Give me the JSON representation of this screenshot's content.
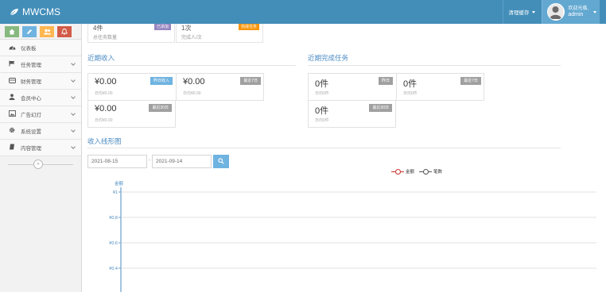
{
  "brand": {
    "title": "MWCMS",
    "logo_icon": "leaf-icon"
  },
  "navbar": {
    "clear_cache": "清理缓存",
    "welcome": "欢迎光临,",
    "username": "admin"
  },
  "colors": {
    "navbar": "#438eb9",
    "section_title": "#4a8bc2",
    "sidebar_bg": "#f2f2f2"
  },
  "sidebar": {
    "shortcuts": [
      {
        "icon": "home-icon",
        "color": "#87b87f"
      },
      {
        "icon": "pencil-icon",
        "color": "#6fb3e0"
      },
      {
        "icon": "users-icon",
        "color": "#ffb752"
      },
      {
        "icon": "bell-icon",
        "color": "#d15b47"
      }
    ],
    "items": [
      {
        "label": "仪表板",
        "icon": "dashboard-icon",
        "expandable": false
      },
      {
        "label": "任务管理",
        "icon": "flag-icon",
        "expandable": true
      },
      {
        "label": "财务管理",
        "icon": "wallet-icon",
        "expandable": true
      },
      {
        "label": "会员中心",
        "icon": "user-icon",
        "expandable": true
      },
      {
        "label": "广告幻灯",
        "icon": "picture-icon",
        "expandable": true
      },
      {
        "label": "系统设置",
        "icon": "gear-icon",
        "expandable": true
      },
      {
        "label": "内容管理",
        "icon": "book-icon",
        "expandable": true
      }
    ]
  },
  "top_partials": [
    {
      "big": "4件",
      "small": "总任务数量",
      "badge": "已添加",
      "badge_color": "#9585bf"
    },
    {
      "big": "1次",
      "small": "完成人/次",
      "badge": "完成任务",
      "badge_color": "#f89406"
    }
  ],
  "income": {
    "title": "近期收入",
    "cards": [
      {
        "value": "¥0.00",
        "sub": "日均¥0.00",
        "tag": "昨日收入"
      },
      {
        "value": "¥0.00",
        "sub": "日均¥0.00",
        "tag": "最近7日"
      },
      {
        "value": "¥0.00",
        "sub": "日均¥0.00",
        "tag": "最近30日"
      }
    ]
  },
  "tasks": {
    "title": "近期完成任务",
    "cards": [
      {
        "value": "0件",
        "sub": "日均0件",
        "tag": "昨日"
      },
      {
        "value": "0件",
        "sub": "日均0件",
        "tag": "最近7日"
      },
      {
        "value": "0件",
        "sub": "日均0件",
        "tag": "最近30日"
      }
    ]
  },
  "trend": {
    "title": "收入线形图",
    "date_from": "2021-08-15",
    "date_sep": "-",
    "date_to": "2021-09-14",
    "search_icon": "search-icon",
    "legend": [
      "金额",
      "笔数"
    ]
  },
  "chart_data": {
    "type": "line",
    "ylabel": "金额",
    "y_ticks": [
      "¥1",
      "¥0.8",
      "¥0.6",
      "¥0.4"
    ],
    "ylim": [
      0,
      1
    ],
    "grid": true,
    "series": [
      {
        "name": "金额",
        "values": []
      },
      {
        "name": "笔数",
        "values": []
      }
    ],
    "legend_position": "top-right"
  }
}
